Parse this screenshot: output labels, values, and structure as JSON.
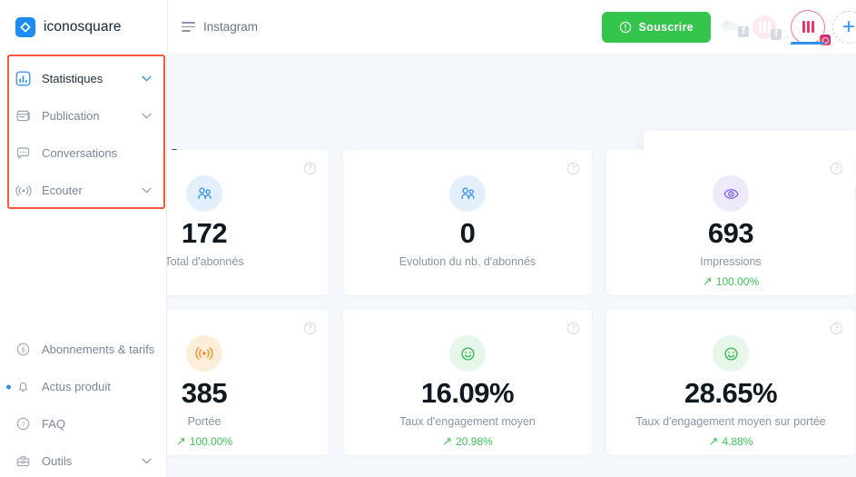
{
  "brand": {
    "name": "iconosquare",
    "logo_icon": "iconosquare-logo"
  },
  "header": {
    "menu_icon": "hamburger-icon",
    "channel": "Instagram",
    "subscribe_label": "Souscrire",
    "subscribe_icon": "clock-icon",
    "subscribe_color": "#35c44c",
    "add_account_icon": "plus-icon",
    "accounts": [
      {
        "name": "cloud-avatar",
        "platform_badge": "facebook-badge",
        "state": "faded"
      },
      {
        "name": "instagram-avatar",
        "platform_badge": "facebook-badge",
        "state": "faded"
      },
      {
        "name": "instagram-avatar",
        "platform_badge": "instagram-badge",
        "state": "selected"
      }
    ]
  },
  "sidebar": {
    "top_items": [
      {
        "label": "Statistiques",
        "icon": "bar-chart-icon",
        "expandable": true,
        "active": true
      },
      {
        "label": "Publication",
        "icon": "publication-icon",
        "expandable": true,
        "active": false
      },
      {
        "label": "Conversations",
        "icon": "chat-bubble-icon",
        "expandable": false,
        "active": false
      },
      {
        "label": "Ecouter",
        "icon": "broadcast-icon",
        "expandable": true,
        "active": false
      }
    ],
    "bottom_items": [
      {
        "label": "Abonnements & tarifs",
        "icon": "dollar-circle-icon",
        "expandable": false,
        "badge": false
      },
      {
        "label": "Actus produit",
        "icon": "bell-icon",
        "expandable": false,
        "badge": true
      },
      {
        "label": "FAQ",
        "icon": "question-circle-icon",
        "expandable": false,
        "badge": false
      },
      {
        "label": "Outils",
        "icon": "toolbox-icon",
        "expandable": true,
        "badge": false
      }
    ],
    "highlight_color": "#f9573c"
  },
  "main": {
    "page_title": "emble",
    "cards": [
      {
        "value": "172",
        "label": "Total d'abonnés",
        "icon": "followers-icon",
        "icon_theme": "blue",
        "delta": null,
        "help": true
      },
      {
        "value": "0",
        "label": "Evolution du nb. d'abonnés",
        "icon": "followers-icon",
        "icon_theme": "blue",
        "delta": null,
        "help": true
      },
      {
        "value": "693",
        "label": "Impressions",
        "icon": "eye-icon",
        "icon_theme": "purple",
        "delta": "100.00%",
        "delta_direction": "up",
        "help": true
      },
      {
        "value": "385",
        "label": "Portée",
        "icon": "broadcast-icon",
        "icon_theme": "orange",
        "delta": "100.00%",
        "delta_direction": "up",
        "help": true
      },
      {
        "value": "16.09%",
        "label": "Taux d'engagement moyen",
        "icon": "smiley-icon",
        "icon_theme": "green",
        "delta": "20.98%",
        "delta_direction": "up",
        "help": true
      },
      {
        "value": "28.65%",
        "label": "Taux d'engagement moyen sur portée",
        "icon": "smiley-icon",
        "icon_theme": "green",
        "delta": "4.88%",
        "delta_direction": "up",
        "help": true
      }
    ],
    "delta_color": "#3cc457",
    "background": "#f4f7fb"
  }
}
